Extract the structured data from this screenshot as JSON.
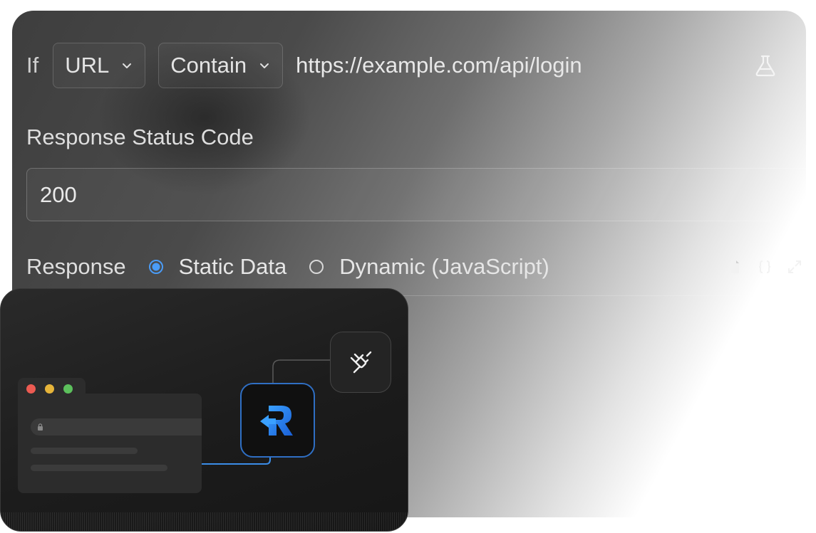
{
  "rule": {
    "if_label": "If",
    "source_select": "URL",
    "operator_select": "Contain",
    "url_value": "https://example.com/api/login"
  },
  "status": {
    "label": "Response Status Code",
    "value": "200"
  },
  "response": {
    "label": "Response",
    "options": [
      {
        "label": "Static Data",
        "selected": true
      },
      {
        "label": "Dynamic (JavaScript)",
        "selected": false
      }
    ]
  },
  "icons": {
    "flask": "flask-icon",
    "copy": "copy-icon",
    "braces": "code-braces-icon",
    "expand": "expand-icon",
    "plug": "plug-icon",
    "logo": "requestly-logo-icon"
  },
  "colors": {
    "accent": "#4a9cf7",
    "traffic_red": "#ec5b52",
    "traffic_yellow": "#e6b43a",
    "traffic_green": "#5cc05c"
  }
}
